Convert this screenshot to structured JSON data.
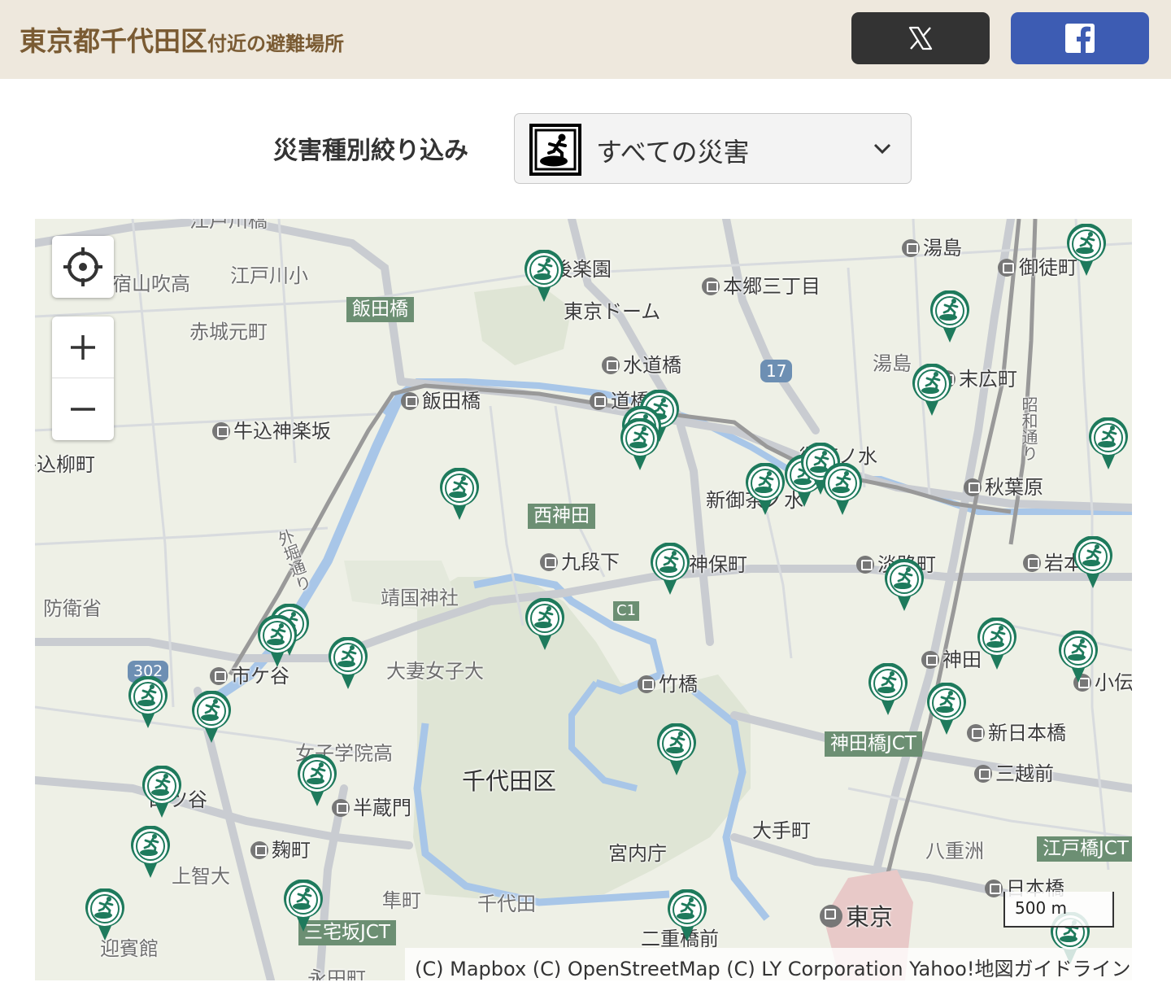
{
  "header": {
    "title_main": "東京都千代田区",
    "title_sub": "付近の避難場所",
    "share_x_icon": "x-logo",
    "share_facebook_icon": "facebook-logo",
    "x_color": "#333333",
    "facebook_color": "#3d5cb3"
  },
  "filter": {
    "label": "災害種別絞り込み",
    "selected": "すべての災害",
    "icon": "evacuation-icon"
  },
  "map": {
    "marker_color": "#1e7a5c",
    "labels": {
      "edogawabashi": "江戸川橋",
      "nakasaka": "宿山吹高",
      "edogawa_sho": "江戸川小",
      "akagi": "赤城元町",
      "iidabashi_tag": "飯田橋",
      "korakuen": "後楽園",
      "dome": "東京ドーム",
      "hongo": "本郷三丁目",
      "yushima": "湯島",
      "okachimachi": "御徒町",
      "suidobashi": "水道橋",
      "route17": "17",
      "yushima2": "湯島",
      "suehirocho": "末広町",
      "iidabashi": "飯田橋",
      "sta_bashi": "道橋",
      "showa": "昭和通り",
      "ushigome": "牛込神楽坂",
      "yanagicho": "牛込柳町",
      "ochanomizu": "御茶ノ水",
      "shin_ochanomizu": "新御茶ノ水",
      "akihabara": "秋葉原",
      "nishikanda_tag": "西神田",
      "kudanshita": "九段下",
      "jimbocho": "神保町",
      "awajicho": "淡路町",
      "iwamoto": "岩本町",
      "yasukuni": "靖国神社",
      "soto": "外堀通り",
      "boei": "防衛省",
      "c1": "C1",
      "route302": "302",
      "ichigaya": "市ケ谷",
      "otsuma": "大妻女子大",
      "takebashi": "竹橋",
      "kanda": "神田",
      "kodenma": "小伝",
      "kandabashi_tag": "神田橋JCT",
      "shin_nihonbashi": "新日本橋",
      "joshi": "女子学院高",
      "chiyoda": "千代田区",
      "mitsukoshi": "三越前",
      "yotsuya": "四ツ谷",
      "hanzomon": "半蔵門",
      "otemachi": "大手町",
      "kojimachi": "麹町",
      "kunaicho": "宮内庁",
      "yaesu": "八重洲",
      "edobashi_tag": "江戸橋JCT",
      "jochi": "上智大",
      "hayabusa": "隼町",
      "chiyoda2": "千代田",
      "nihonbashi": "日本橋",
      "tokyo": "東京",
      "geihinkan": "迎賓館",
      "miyakezaka_tag": "三宅坂JCT",
      "nijubashi": "二重橋前",
      "nagatacho": "永田町"
    },
    "controls": {
      "locate_icon": "crosshair-icon",
      "zoom_in": "+",
      "zoom_out": "−"
    },
    "scale": "500 m",
    "attribution": "(C) Mapbox (C) OpenStreetMap (C) LY Corporation Yahoo!地図ガイドライン"
  }
}
